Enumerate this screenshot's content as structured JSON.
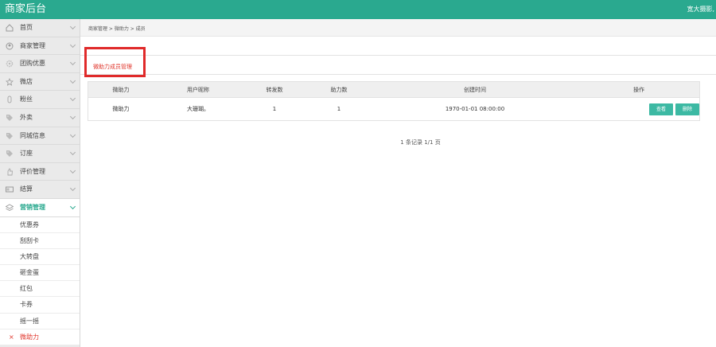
{
  "app": {
    "brand": "商家后台",
    "user_text": "宽大摄影,"
  },
  "sidebar": {
    "items": [
      {
        "label": "首页",
        "icon": "home-icon"
      },
      {
        "label": "商家管理",
        "icon": "user-circle-icon"
      },
      {
        "label": "团购优惠",
        "icon": "gear-icon"
      },
      {
        "label": "微店",
        "icon": "star-icon"
      },
      {
        "label": "粉丝",
        "icon": "fan-icon"
      },
      {
        "label": "外卖",
        "icon": "tag-icon"
      },
      {
        "label": "同城信息",
        "icon": "tag-icon"
      },
      {
        "label": "订座",
        "icon": "tag-icon"
      },
      {
        "label": "评价管理",
        "icon": "thumb-icon"
      },
      {
        "label": "结算",
        "icon": "card-icon"
      },
      {
        "label": "营销管理",
        "icon": "layers-icon"
      }
    ],
    "subitems": [
      {
        "label": "优惠券"
      },
      {
        "label": "刮刮卡"
      },
      {
        "label": "大转盘"
      },
      {
        "label": "砸金蛋"
      },
      {
        "label": "红包"
      },
      {
        "label": "卡券"
      },
      {
        "label": "摇一摇"
      },
      {
        "label": "微助力",
        "marker": "×"
      }
    ]
  },
  "breadcrumb": "商家管理 > 微助力 > 成员",
  "tab": {
    "label": "微助力成员管理"
  },
  "table": {
    "headers": [
      "微助力",
      "用户昵称",
      "转发数",
      "助力数",
      "创建时间",
      "操作"
    ],
    "rows": [
      [
        "微助力",
        "大珊瑚。",
        "1",
        "1",
        "1970-01-01 08:00:00"
      ]
    ],
    "actions": {
      "view": "查看",
      "delete": "删除"
    }
  },
  "pager": "1 条记录 1/1 页",
  "colors": {
    "accent": "#2aa98f",
    "button": "#3cb9a3",
    "highlight": "#e02a2a"
  }
}
